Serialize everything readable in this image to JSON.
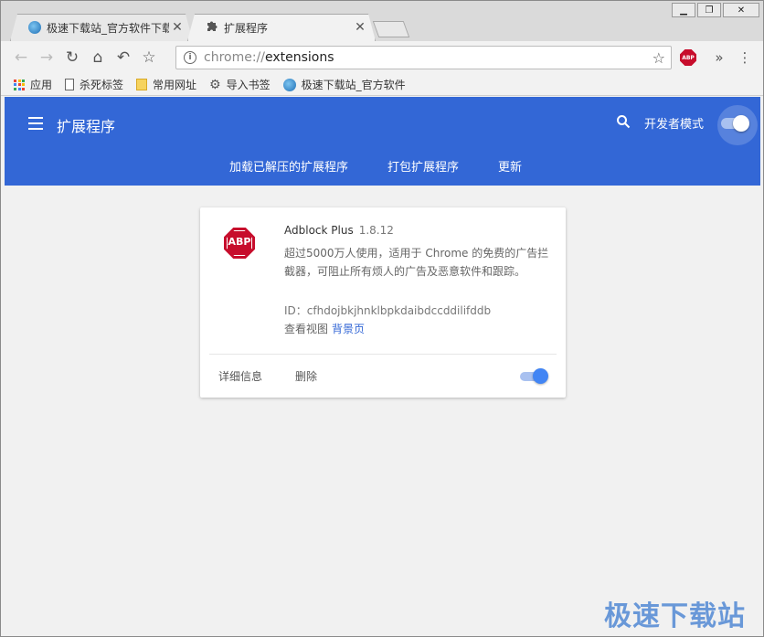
{
  "tabs": [
    {
      "title": "极速下载站_官方软件下载",
      "active": false
    },
    {
      "title": "扩展程序",
      "active": true
    }
  ],
  "toolbar": {
    "url_scheme": "chrome://",
    "url_host": "extensions"
  },
  "bookmarks": [
    {
      "label": "应用",
      "icon": "apps-icon"
    },
    {
      "label": "杀死标签",
      "icon": "page-icon"
    },
    {
      "label": "常用网址",
      "icon": "folder-icon"
    },
    {
      "label": "导入书签",
      "icon": "gear-icon"
    },
    {
      "label": "极速下载站_官方软件",
      "icon": "globe-icon"
    }
  ],
  "header": {
    "title": "扩展程序",
    "dev_mode_label": "开发者模式",
    "dev_mode_on": true,
    "actions": [
      "加载已解压的扩展程序",
      "打包扩展程序",
      "更新"
    ]
  },
  "extension": {
    "name": "Adblock Plus",
    "version": "1.8.12",
    "logo_text": "ABP",
    "description": "超过5000万人使用，适用于 Chrome 的免费的广告拦截器，可阻止所有烦人的广告及恶意软件和跟踪。",
    "id_text": "ID：cfhdojbkjhnklbpkdaibdccddilifddb",
    "views_label": "查看视图",
    "views_link": "背景页",
    "details_button": "详细信息",
    "remove_button": "删除",
    "enabled": true
  },
  "colors": {
    "header_bg": "#3367d6",
    "toggle_on": "#4285f4",
    "abp_red": "#c70d2c"
  },
  "watermark": "极速下载站"
}
